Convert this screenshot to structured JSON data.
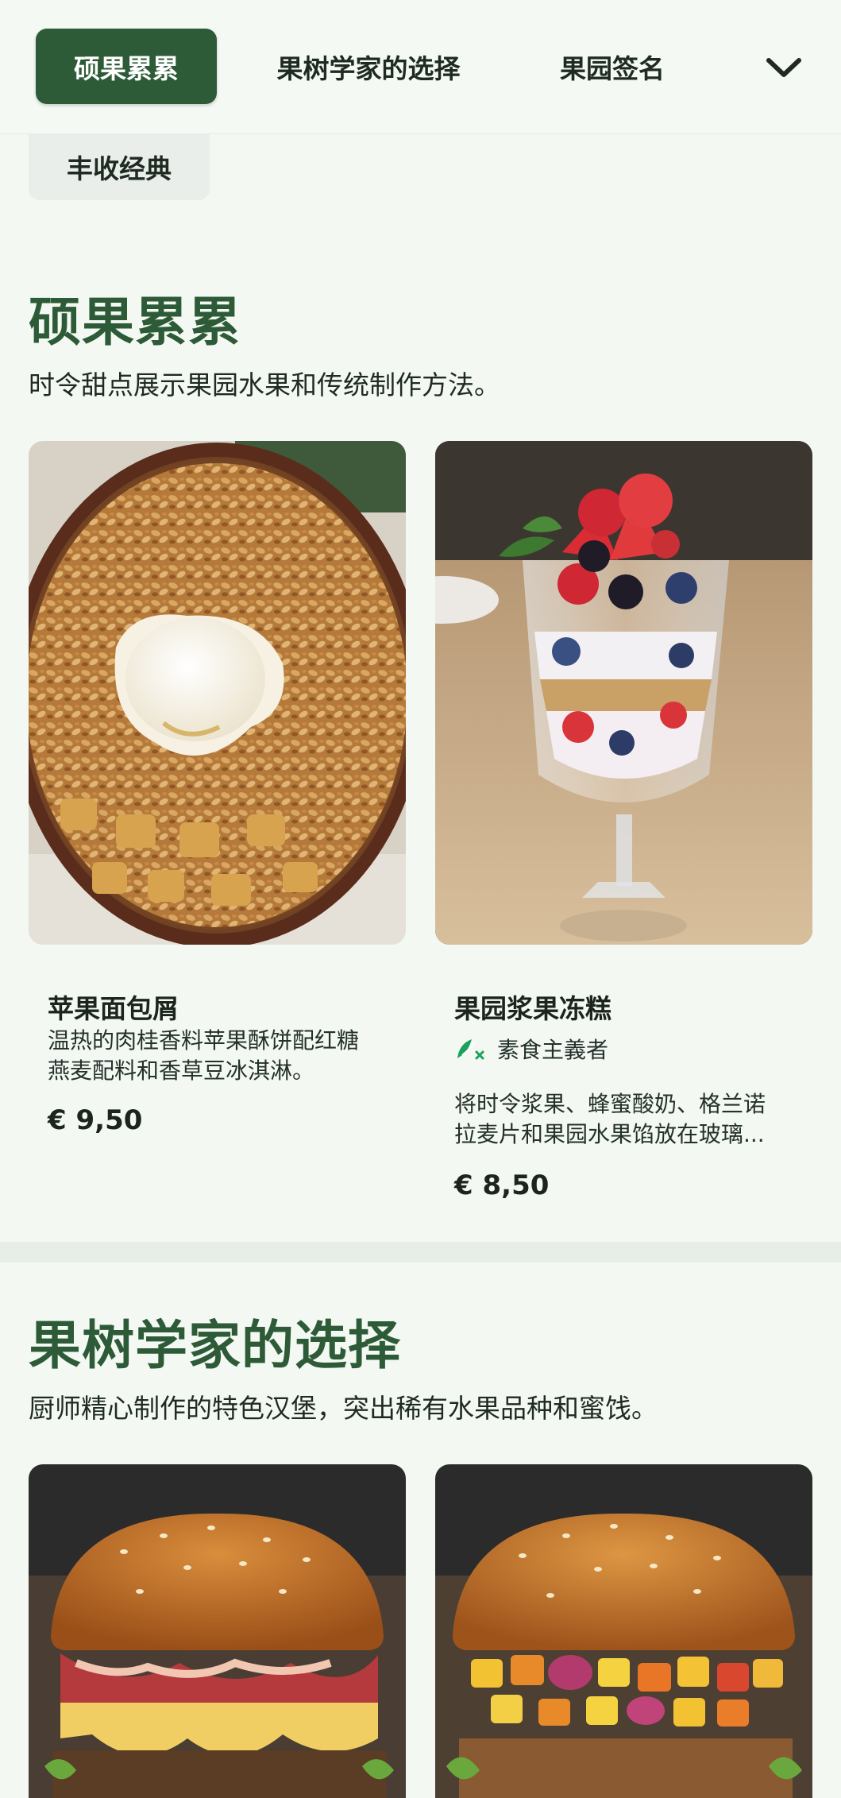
{
  "tabs": {
    "items": [
      "硕果累累",
      "果树学家的选择",
      "果园签名"
    ],
    "overflow_item": "丰收经典",
    "active_index": 0
  },
  "sections": [
    {
      "title": "硕果累累",
      "description": "时令甜点展示果园水果和传统制作方法。",
      "items": [
        {
          "name": "苹果面包屑",
          "description_lines": [
            "温热的肉桂香料苹果酥饼配红糖",
            "燕麦配料和香草豆冰淇淋。"
          ],
          "price": "€ 9,50"
        },
        {
          "name": "果园浆果冻糕",
          "tag": "素食主義者",
          "description_lines": [
            "将时令浆果、蜂蜜酸奶、格兰诺",
            "拉麦片和果园水果馅放在玻璃..."
          ],
          "price": "€ 8,50"
        }
      ]
    },
    {
      "title": "果树学家的选择",
      "description": "厨师精心制作的特色汉堡，突出稀有水果品种和蜜饯。"
    }
  ],
  "colors": {
    "accent": "#2e5b37",
    "background": "#f3f8f3",
    "tag_icon": "#1aa15a"
  },
  "icons": {
    "dropdown": "chevron-down-icon",
    "tag": "vegetarian-leaf-icon"
  }
}
